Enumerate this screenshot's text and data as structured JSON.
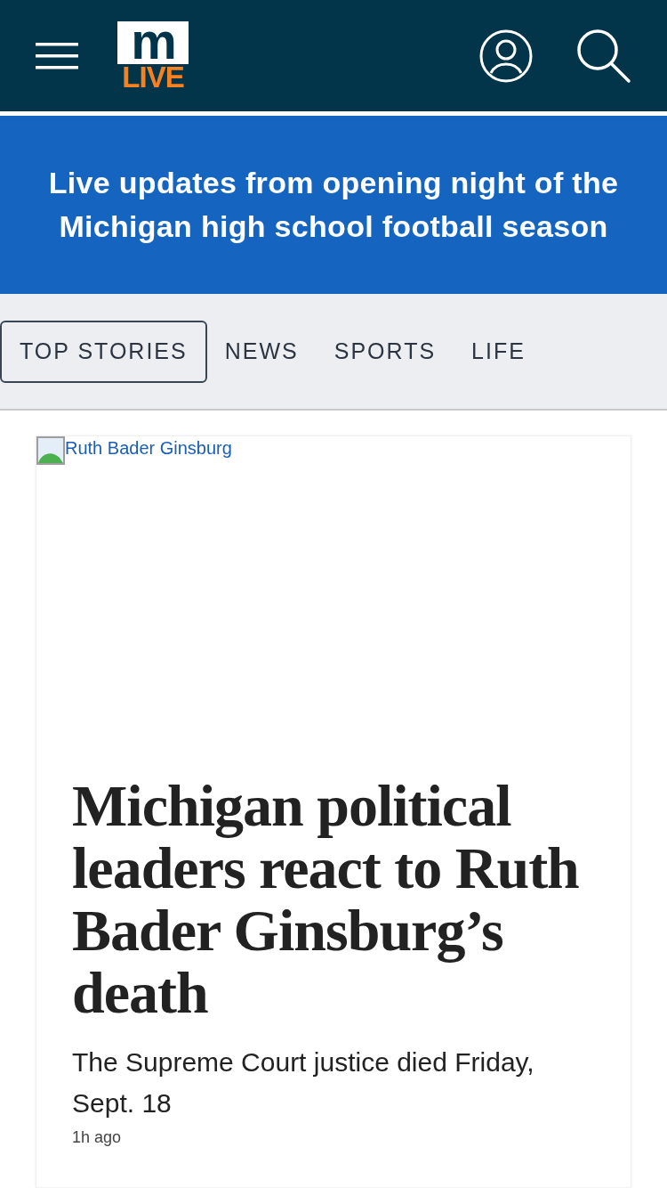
{
  "header": {
    "logo": {
      "top": "m",
      "bottom": "LIVE"
    }
  },
  "banner": {
    "text": "Live updates from opening night of the Michigan high school football season"
  },
  "tabs": [
    {
      "label": "TOP STORIES",
      "selected": true
    },
    {
      "label": "NEWS",
      "selected": false
    },
    {
      "label": "SPORTS",
      "selected": false
    },
    {
      "label": "LIFE",
      "selected": false
    }
  ],
  "story": {
    "image_alt": "Ruth Bader Ginsburg",
    "headline": "Michigan political leaders react to Ruth Bader Ginsburg’s death",
    "summary": "The Supreme Court justice died Friday, Sept. 18",
    "time": "1h ago"
  }
}
